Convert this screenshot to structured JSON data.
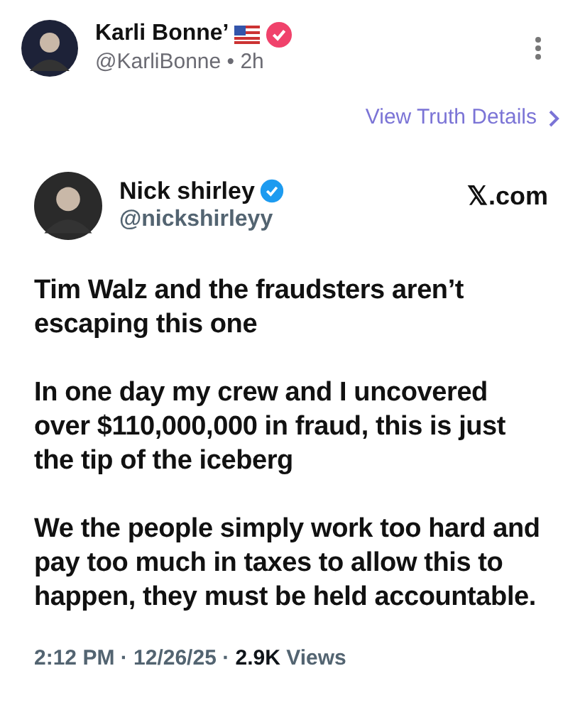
{
  "post": {
    "author": {
      "name": "Karli Bonne’",
      "handle": "@KarliBonne",
      "separator": "•",
      "time": "2h"
    },
    "details_link": "View Truth Details"
  },
  "quoted": {
    "author": {
      "name": "Nick shirley",
      "handle": "@nickshirleyy"
    },
    "source": "𝕏.com",
    "paragraphs": [
      "Tim Walz and the fraudsters aren’t escaping this one",
      "In one day my crew and I uncovered over $110,000,000 in fraud, this is just the tip of the iceberg",
      "We the people simply work too hard and pay too much in taxes to allow this to happen, they must be held accountable."
    ],
    "meta": "2:12 PM · 12/26/25 · **2.9K** Views"
  }
}
